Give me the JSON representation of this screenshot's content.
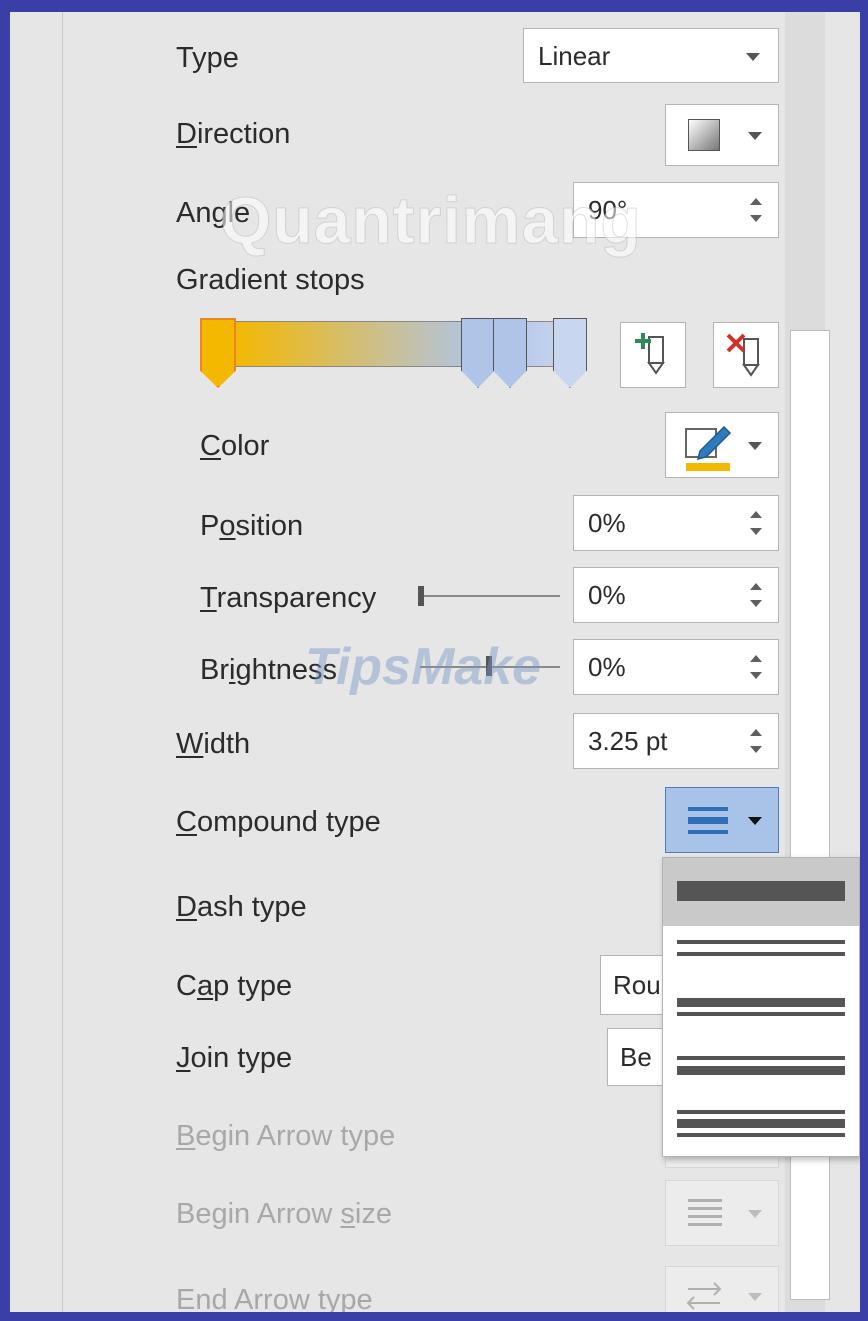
{
  "fields": {
    "type": {
      "label": "Type",
      "value": "Linear"
    },
    "direction": {
      "label": "Direction"
    },
    "angle": {
      "label": "Angle",
      "value": "90°"
    },
    "gradient_stops": {
      "label": "Gradient stops"
    },
    "color": {
      "label": "Color"
    },
    "position": {
      "label": "Position",
      "value": "0%"
    },
    "transparency": {
      "label": "Transparency",
      "value": "0%",
      "slider_fraction": 0
    },
    "brightness": {
      "label": "Brightness",
      "value": "0%",
      "slider_fraction": 0.5
    },
    "width": {
      "label": "Width",
      "value": "3.25 pt"
    },
    "compound_type": {
      "label": "Compound type"
    },
    "dash_type": {
      "label": "Dash type"
    },
    "cap_type": {
      "label": "Cap type",
      "value": "Rou"
    },
    "join_type": {
      "label": "Join type",
      "value": "Be"
    },
    "begin_arrow_type": {
      "label": "Begin Arrow type"
    },
    "begin_arrow_size": {
      "label": "Begin Arrow size"
    },
    "end_arrow_type": {
      "label": "End Arrow type"
    }
  },
  "gradient": {
    "start_color": "#f5b800",
    "end_color": "#b0c4e8",
    "stop_color_selected": "#f5b800",
    "stop_color_other": "#b0c4e8"
  },
  "icons": {
    "direction": "gradient-direction-icon",
    "add_stop": "add-gradient-stop-icon",
    "remove_stop": "remove-gradient-stop-icon",
    "color": "pen-color-icon",
    "compound": "compound-lines-icon"
  },
  "compound_options": [
    "single",
    "double",
    "thick-thin",
    "thin-thick",
    "triple"
  ],
  "compound_selected": "single",
  "watermarks": [
    "Quantrimang",
    "TipsMake"
  ]
}
